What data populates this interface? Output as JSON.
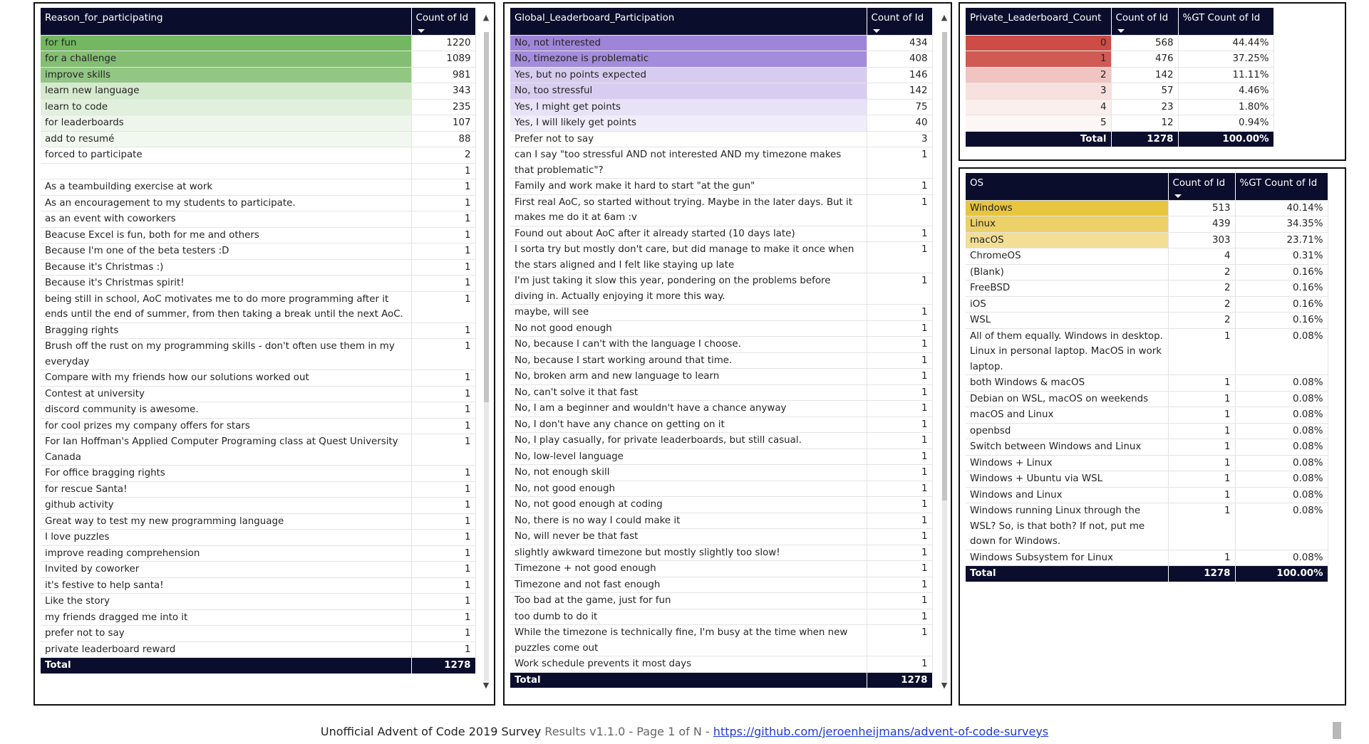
{
  "reason_table": {
    "headers": [
      "Reason_for_participating",
      "Count of Id"
    ],
    "rows": [
      {
        "label": "for fun",
        "count": "1220",
        "bg": "#73b761"
      },
      {
        "label": "for a challenge",
        "count": "1089",
        "bg": "#83be73"
      },
      {
        "label": "improve skills",
        "count": "981",
        "bg": "#91c683"
      },
      {
        "label": "learn new language",
        "count": "343",
        "bg": "#d4e9cd"
      },
      {
        "label": "learn to code",
        "count": "235",
        "bg": "#e1f0dc"
      },
      {
        "label": "for leaderboards",
        "count": "107",
        "bg": "#eef6ec"
      },
      {
        "label": "add to resumé",
        "count": "88",
        "bg": "#f1f8ef"
      },
      {
        "label": "forced to participate",
        "count": "2",
        "bg": ""
      },
      {
        "label": "",
        "count": "1",
        "bg": ""
      },
      {
        "label": "As a teambuilding exercise at work",
        "count": "1",
        "bg": ""
      },
      {
        "label": "As an encouragement to my students to participate.",
        "count": "1",
        "bg": ""
      },
      {
        "label": "as an event with coworkers",
        "count": "1",
        "bg": ""
      },
      {
        "label": "Beacuse Excel is fun, both for me and others",
        "count": "1",
        "bg": ""
      },
      {
        "label": "Because I'm one of the beta testers :D",
        "count": "1",
        "bg": ""
      },
      {
        "label": "Because it's Christmas :)",
        "count": "1",
        "bg": ""
      },
      {
        "label": "Because it's Christmas spirit!",
        "count": "1",
        "bg": ""
      },
      {
        "label": "being still in school, AoC motivates me to do more programming after it ends until the end of summer, from then taking a break until the next AoC.",
        "count": "1",
        "bg": ""
      },
      {
        "label": "Bragging rights",
        "count": "1",
        "bg": ""
      },
      {
        "label": "Brush off the rust on my programming skills - don't often use them in my everyday",
        "count": "1",
        "bg": ""
      },
      {
        "label": "Compare with my friends how our solutions worked out",
        "count": "1",
        "bg": ""
      },
      {
        "label": "Contest at university",
        "count": "1",
        "bg": ""
      },
      {
        "label": "discord community is awesome.",
        "count": "1",
        "bg": ""
      },
      {
        "label": "for cool prizes my company offers for stars",
        "count": "1",
        "bg": ""
      },
      {
        "label": "For Ian Hoffman's Applied Computer Programing class at Quest University Canada",
        "count": "1",
        "bg": ""
      },
      {
        "label": "For office bragging rights",
        "count": "1",
        "bg": ""
      },
      {
        "label": "for rescue Santa!",
        "count": "1",
        "bg": ""
      },
      {
        "label": "github activity",
        "count": "1",
        "bg": ""
      },
      {
        "label": "Great way to test my new programming language",
        "count": "1",
        "bg": ""
      },
      {
        "label": "I love puzzles",
        "count": "1",
        "bg": ""
      },
      {
        "label": "improve reading comprehension",
        "count": "1",
        "bg": ""
      },
      {
        "label": "Invited by coworker",
        "count": "1",
        "bg": ""
      },
      {
        "label": "it's festive to help santa!",
        "count": "1",
        "bg": ""
      },
      {
        "label": "Like the story",
        "count": "1",
        "bg": ""
      },
      {
        "label": "my friends dragged me into it",
        "count": "1",
        "bg": ""
      },
      {
        "label": "prefer not to say",
        "count": "1",
        "bg": ""
      },
      {
        "label": "private leaderboard reward",
        "count": "1",
        "bg": ""
      }
    ],
    "total_label": "Total",
    "total_value": "1278"
  },
  "global_table": {
    "headers": [
      "Global_Leaderboard_Participation",
      "Count of Id"
    ],
    "rows": [
      {
        "label": "No, not interested",
        "count": "434",
        "bg": "#9f85d9"
      },
      {
        "label": "No, timezone is problematic",
        "count": "408",
        "bg": "#a48cdc"
      },
      {
        "label": "Yes, but no points expected",
        "count": "146",
        "bg": "#d7ccf0"
      },
      {
        "label": "No, too stressful",
        "count": "142",
        "bg": "#d8cdf1"
      },
      {
        "label": "Yes, I might get points",
        "count": "75",
        "bg": "#e8e2f7"
      },
      {
        "label": "Yes, I will likely get points",
        "count": "40",
        "bg": "#f0ecfa"
      },
      {
        "label": "Prefer not to say",
        "count": "3",
        "bg": ""
      },
      {
        "label": "can I say \"too stressful AND not interested AND my timezone makes that problematic\"?",
        "count": "1",
        "bg": ""
      },
      {
        "label": "Family and work make it hard to start \"at the gun\"",
        "count": "1",
        "bg": ""
      },
      {
        "label": "First real AoC, so started without trying. Maybe in the later days. But it makes me do it at 6am :v",
        "count": "1",
        "bg": ""
      },
      {
        "label": "Found out about AoC after it already started (10 days late)",
        "count": "1",
        "bg": ""
      },
      {
        "label": "I sorta try but mostly don't care, but did manage to make it once when the stars aligned and I felt like staying up late",
        "count": "1",
        "bg": ""
      },
      {
        "label": "I'm just taking it slow this year, pondering on the problems before diving in. Actually enjoying it more this way.",
        "count": "1",
        "bg": ""
      },
      {
        "label": "maybe, will see",
        "count": "1",
        "bg": ""
      },
      {
        "label": "No not good enough",
        "count": "1",
        "bg": ""
      },
      {
        "label": "No, because I can't with the language I choose.",
        "count": "1",
        "bg": ""
      },
      {
        "label": "No, because I start working around that time.",
        "count": "1",
        "bg": ""
      },
      {
        "label": "No, broken arm and new language to learn",
        "count": "1",
        "bg": ""
      },
      {
        "label": "No, can't solve it that fast",
        "count": "1",
        "bg": ""
      },
      {
        "label": "No, I am a beginner and wouldn't have a chance anyway",
        "count": "1",
        "bg": ""
      },
      {
        "label": "No, I don't have any chance on getting on it",
        "count": "1",
        "bg": ""
      },
      {
        "label": "No, I play casually, for private leaderboards, but still casual.",
        "count": "1",
        "bg": ""
      },
      {
        "label": "No, low-level language",
        "count": "1",
        "bg": ""
      },
      {
        "label": "No, not enough skill",
        "count": "1",
        "bg": ""
      },
      {
        "label": "No, not good enough",
        "count": "1",
        "bg": ""
      },
      {
        "label": "No, not good enough at coding",
        "count": "1",
        "bg": ""
      },
      {
        "label": "No, there is no way I could make it",
        "count": "1",
        "bg": ""
      },
      {
        "label": "No, will never be that fast",
        "count": "1",
        "bg": ""
      },
      {
        "label": "slightly awkward timezone but mostly slightly too slow!",
        "count": "1",
        "bg": ""
      },
      {
        "label": "Timezone + not good enough",
        "count": "1",
        "bg": ""
      },
      {
        "label": "Timezone and not fast enough",
        "count": "1",
        "bg": ""
      },
      {
        "label": "Too bad at the game, just for fun",
        "count": "1",
        "bg": ""
      },
      {
        "label": "too dumb to do it",
        "count": "1",
        "bg": ""
      },
      {
        "label": "While the timezone is technically fine, I'm busy at the time when new puzzles come out",
        "count": "1",
        "bg": ""
      },
      {
        "label": "Work schedule prevents it most days",
        "count": "1",
        "bg": ""
      }
    ],
    "total_label": "Total",
    "total_value": "1278"
  },
  "private_table": {
    "headers": [
      "Private_Leaderboard_Count",
      "Count of Id",
      "%GT Count of Id"
    ],
    "rows": [
      {
        "label": "0",
        "count": "568",
        "pct": "44.44%",
        "bg": "#cd4c46"
      },
      {
        "label": "1",
        "count": "476",
        "pct": "37.25%",
        "bg": "#d05a54"
      },
      {
        "label": "2",
        "count": "142",
        "pct": "11.11%",
        "bg": "#f0c4c1"
      },
      {
        "label": "3",
        "count": "57",
        "pct": "4.46%",
        "bg": "#f7e0de"
      },
      {
        "label": "4",
        "count": "23",
        "pct": "1.80%",
        "bg": "#fbefee"
      },
      {
        "label": "5",
        "count": "12",
        "pct": "0.94%",
        "bg": "#fdf6f6"
      }
    ],
    "total_label": "Total",
    "total_count": "1278",
    "total_pct": "100.00%"
  },
  "os_table": {
    "headers": [
      "OS",
      "Count of Id",
      "%GT Count of Id"
    ],
    "rows": [
      {
        "label": "Windows",
        "count": "513",
        "pct": "40.14%",
        "bg": "#e8c53f"
      },
      {
        "label": "Linux",
        "count": "439",
        "pct": "34.35%",
        "bg": "#ecd068"
      },
      {
        "label": "macOS",
        "count": "303",
        "pct": "23.71%",
        "bg": "#f2df95"
      },
      {
        "label": "ChromeOS",
        "count": "4",
        "pct": "0.31%",
        "bg": ""
      },
      {
        "label": "(Blank)",
        "count": "2",
        "pct": "0.16%",
        "bg": ""
      },
      {
        "label": "FreeBSD",
        "count": "2",
        "pct": "0.16%",
        "bg": ""
      },
      {
        "label": "iOS",
        "count": "2",
        "pct": "0.16%",
        "bg": ""
      },
      {
        "label": "WSL",
        "count": "2",
        "pct": "0.16%",
        "bg": ""
      },
      {
        "label": "All of them equally. Windows in desktop. Linux in personal laptop. MacOS in work laptop.",
        "count": "1",
        "pct": "0.08%",
        "bg": ""
      },
      {
        "label": "both Windows & macOS",
        "count": "1",
        "pct": "0.08%",
        "bg": ""
      },
      {
        "label": "Debian on WSL, macOS on weekends",
        "count": "1",
        "pct": "0.08%",
        "bg": ""
      },
      {
        "label": "macOS and Linux",
        "count": "1",
        "pct": "0.08%",
        "bg": ""
      },
      {
        "label": "openbsd",
        "count": "1",
        "pct": "0.08%",
        "bg": ""
      },
      {
        "label": "Switch between Windows and Linux",
        "count": "1",
        "pct": "0.08%",
        "bg": ""
      },
      {
        "label": "Windows + Linux",
        "count": "1",
        "pct": "0.08%",
        "bg": ""
      },
      {
        "label": "Windows + Ubuntu via WSL",
        "count": "1",
        "pct": "0.08%",
        "bg": ""
      },
      {
        "label": "Windows and Linux",
        "count": "1",
        "pct": "0.08%",
        "bg": ""
      },
      {
        "label": "Windows running Linux through the WSL? So, is that both? If not, put me down for Windows.",
        "count": "1",
        "pct": "0.08%",
        "bg": ""
      },
      {
        "label": "Windows Subsystem for Linux",
        "count": "1",
        "pct": "0.08%",
        "bg": ""
      }
    ],
    "total_label": "Total",
    "total_count": "1278",
    "total_pct": "100.00%"
  },
  "footer": {
    "title": "Unofficial Advent of Code 2019 Survey",
    "version_text": "Results v1.1.0 - Page 1 of N -",
    "link": "https://github.com/jeroenheijmans/advent-of-code-surveys"
  },
  "scroll": {
    "up": "▲",
    "down": "▼"
  },
  "colors": {
    "header_bg": "#0b0d2c",
    "header_fg": "#ffffff",
    "link": "#1f3bd8"
  }
}
